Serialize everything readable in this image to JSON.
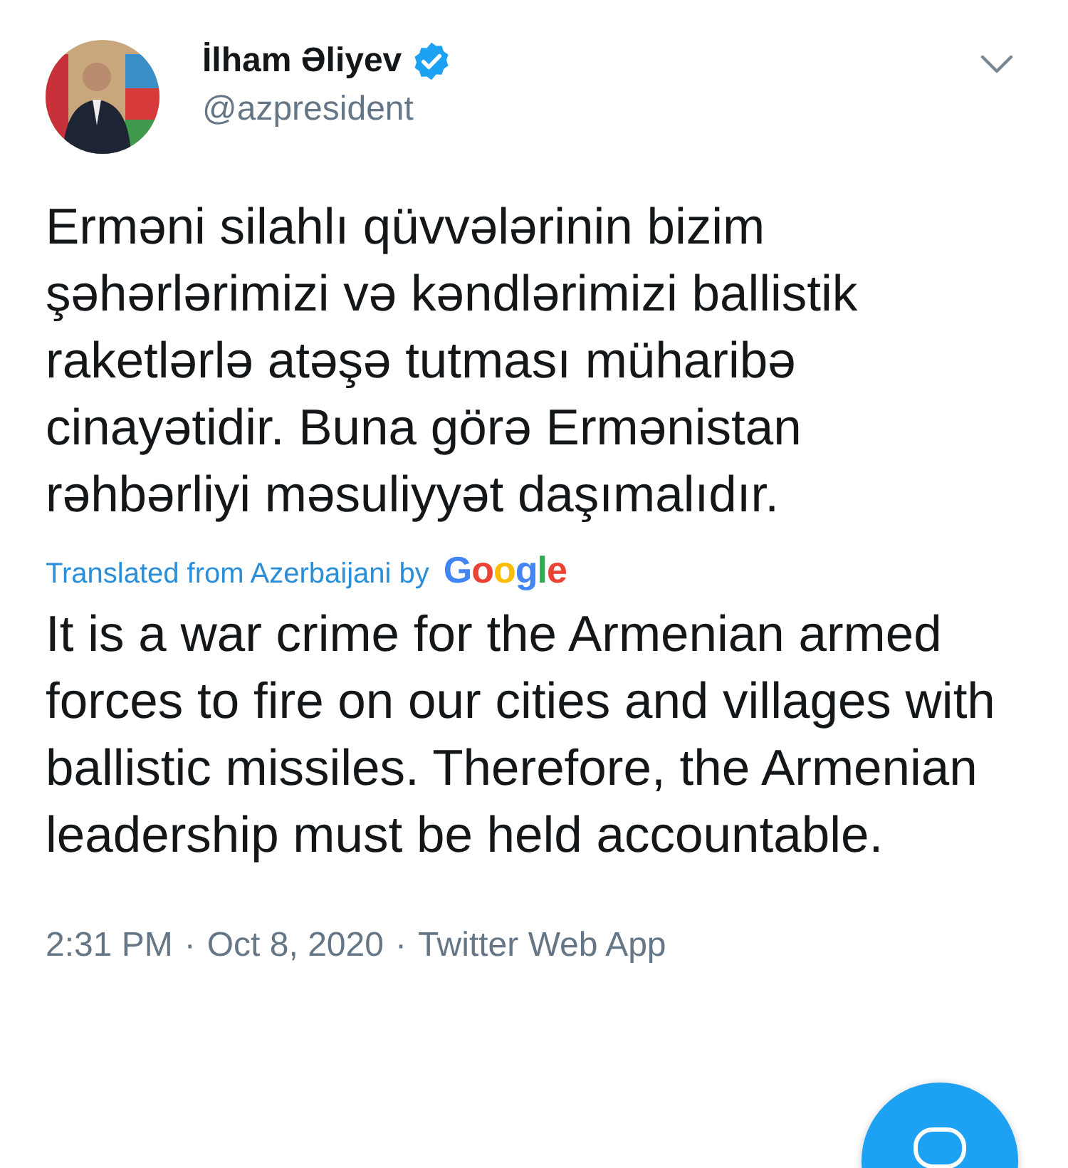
{
  "author": {
    "name": "İlham Əliyev",
    "verified": true,
    "handle": "@azpresident"
  },
  "tweet": {
    "text": "Erməni silahlı qüvvələrinin bizim şəhərlərimizi və kəndlərimizi ballistik raketlərlə atəşə tutması müharibə cinayətidir. Buna görə Ermənistan rəhbərliyi məsuliyyət daşımalıdır.",
    "translation_note": "Translated from Azerbaijani by",
    "translator": "Google",
    "translation": "It is a war crime for the Armenian armed forces to fire on our cities and villages with ballistic missiles. Therefore, the Armenian leadership must be held accountable."
  },
  "meta": [
    "2:31 PM",
    "Oct 8, 2020",
    "Twitter Web App"
  ],
  "meta_separator": "·"
}
